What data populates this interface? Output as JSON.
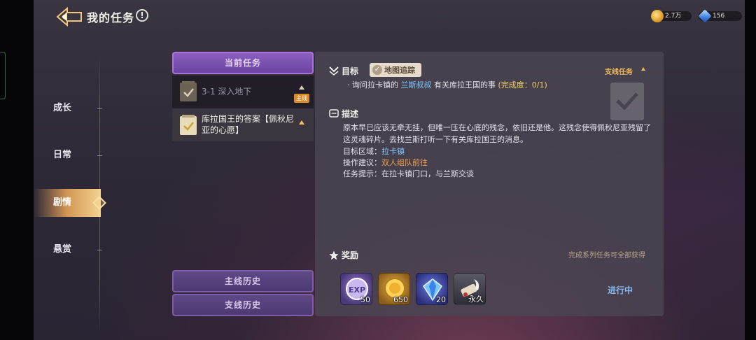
{
  "header": {
    "title": "我的任务",
    "info_symbol": "!",
    "currencies": [
      {
        "name": "gold-coin",
        "value": "2.7万"
      },
      {
        "name": "diamond",
        "value": "156"
      }
    ]
  },
  "nav": {
    "items": [
      {
        "label": "成长",
        "active": false
      },
      {
        "label": "日常",
        "active": false
      },
      {
        "label": "剧情",
        "active": true
      },
      {
        "label": "悬赏",
        "active": false
      }
    ]
  },
  "quest_list": {
    "current_tab": "当前任务",
    "quests": [
      {
        "title": "3-1 深入地下",
        "badge": "主线",
        "selected": false
      },
      {
        "title": "库拉国王的答案【佩秋尼亚的心愿】",
        "badge": "",
        "selected": true
      }
    ],
    "history_main": "主线历史",
    "history_side": "支线历史"
  },
  "detail": {
    "objective_label": "目标",
    "track_label": "地图追踪",
    "quest_type": "支线任务",
    "objective": {
      "prefix": "· 询问拉卡镇的",
      "npc": "兰斯叔叔",
      "suffix": "有关库拉王国的事",
      "progress": "(完成度：0/1)"
    },
    "description_label": "描述",
    "description": "原本早已应该无牵无挂，但唯一压在心底的残念，依旧还是他。这残念使得佩秋尼亚残留了这灵魂碎片。去找兰斯打听一下有关库拉国王的消息。",
    "area_label": "目标区域：",
    "area_value": "拉卡镇",
    "advice_label": "操作建议：",
    "advice_value": "双人组队前往",
    "hint_label": "任务提示：",
    "hint_value": "在拉卡镇门口，与兰斯交谈",
    "reward_label": "奖励",
    "reward_note": "完成系列任务可全部获得",
    "rewards": [
      {
        "icon": "exp-icon",
        "qty": "50"
      },
      {
        "icon": "gold-coin-icon",
        "qty": "650"
      },
      {
        "icon": "diamond-icon",
        "qty": "20"
      },
      {
        "icon": "scroll-quill-icon",
        "qty": "永久"
      }
    ],
    "status": "进行中"
  }
}
